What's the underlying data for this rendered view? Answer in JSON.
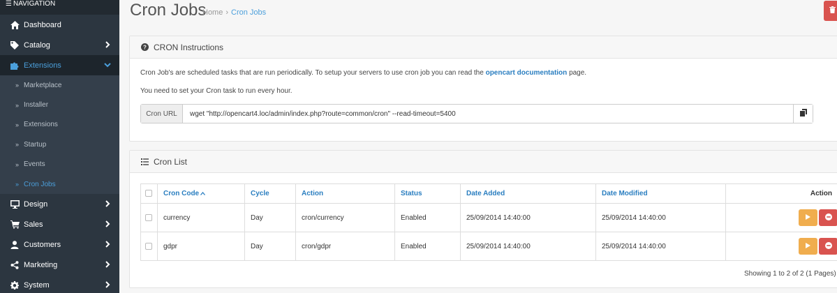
{
  "nav": {
    "title": "NAVIGATION",
    "items": [
      {
        "label": "Dashboard",
        "icon": "home-icon"
      },
      {
        "label": "Catalog",
        "icon": "tag-icon"
      },
      {
        "label": "Extensions",
        "icon": "puzzle-icon"
      },
      {
        "label": "Design",
        "icon": "monitor-icon"
      },
      {
        "label": "Sales",
        "icon": "cart-icon"
      },
      {
        "label": "Customers",
        "icon": "user-icon"
      },
      {
        "label": "Marketing",
        "icon": "share-icon"
      },
      {
        "label": "System",
        "icon": "gear-icon"
      }
    ],
    "extensions_sub": [
      "Marketplace",
      "Installer",
      "Extensions",
      "Startup",
      "Events",
      "Cron Jobs"
    ]
  },
  "header": {
    "title": "Cron Jobs",
    "breadcrumb": {
      "home": "Home",
      "separator": "›",
      "current": "Cron Jobs"
    }
  },
  "instructions": {
    "heading": "CRON Instructions",
    "line1_prefix": "Cron Job's are scheduled tasks that are run periodically. To setup your servers to use cron job you can read the",
    "line1_link": "opencart documentation",
    "line1_suffix": "page.",
    "line2": "You need to set your Cron task to run every hour.",
    "url_label": "Cron URL",
    "url_value": "wget \"http://opencart4.loc/admin/index.php?route=common/cron\" --read-timeout=5400"
  },
  "list": {
    "heading": "Cron List",
    "columns": [
      "Cron Code",
      "Cycle",
      "Action",
      "Status",
      "Date Added",
      "Date Modified",
      "Action"
    ],
    "rows": [
      {
        "code": "currency",
        "cycle": "Day",
        "action": "cron/currency",
        "status": "Enabled",
        "date_added": "25/09/2014 14:40:00",
        "date_modified": "25/09/2014 14:40:00"
      },
      {
        "code": "gdpr",
        "cycle": "Day",
        "action": "cron/gdpr",
        "status": "Enabled",
        "date_added": "25/09/2014 14:40:00",
        "date_modified": "25/09/2014 14:40:00"
      }
    ],
    "pagination": "Showing 1 to 2 of 2 (1 Pages)"
  },
  "colors": {
    "sidebar": "#2c3640",
    "accent": "#4b9fdb",
    "warning": "#f0ad4e",
    "danger": "#d9534f"
  }
}
